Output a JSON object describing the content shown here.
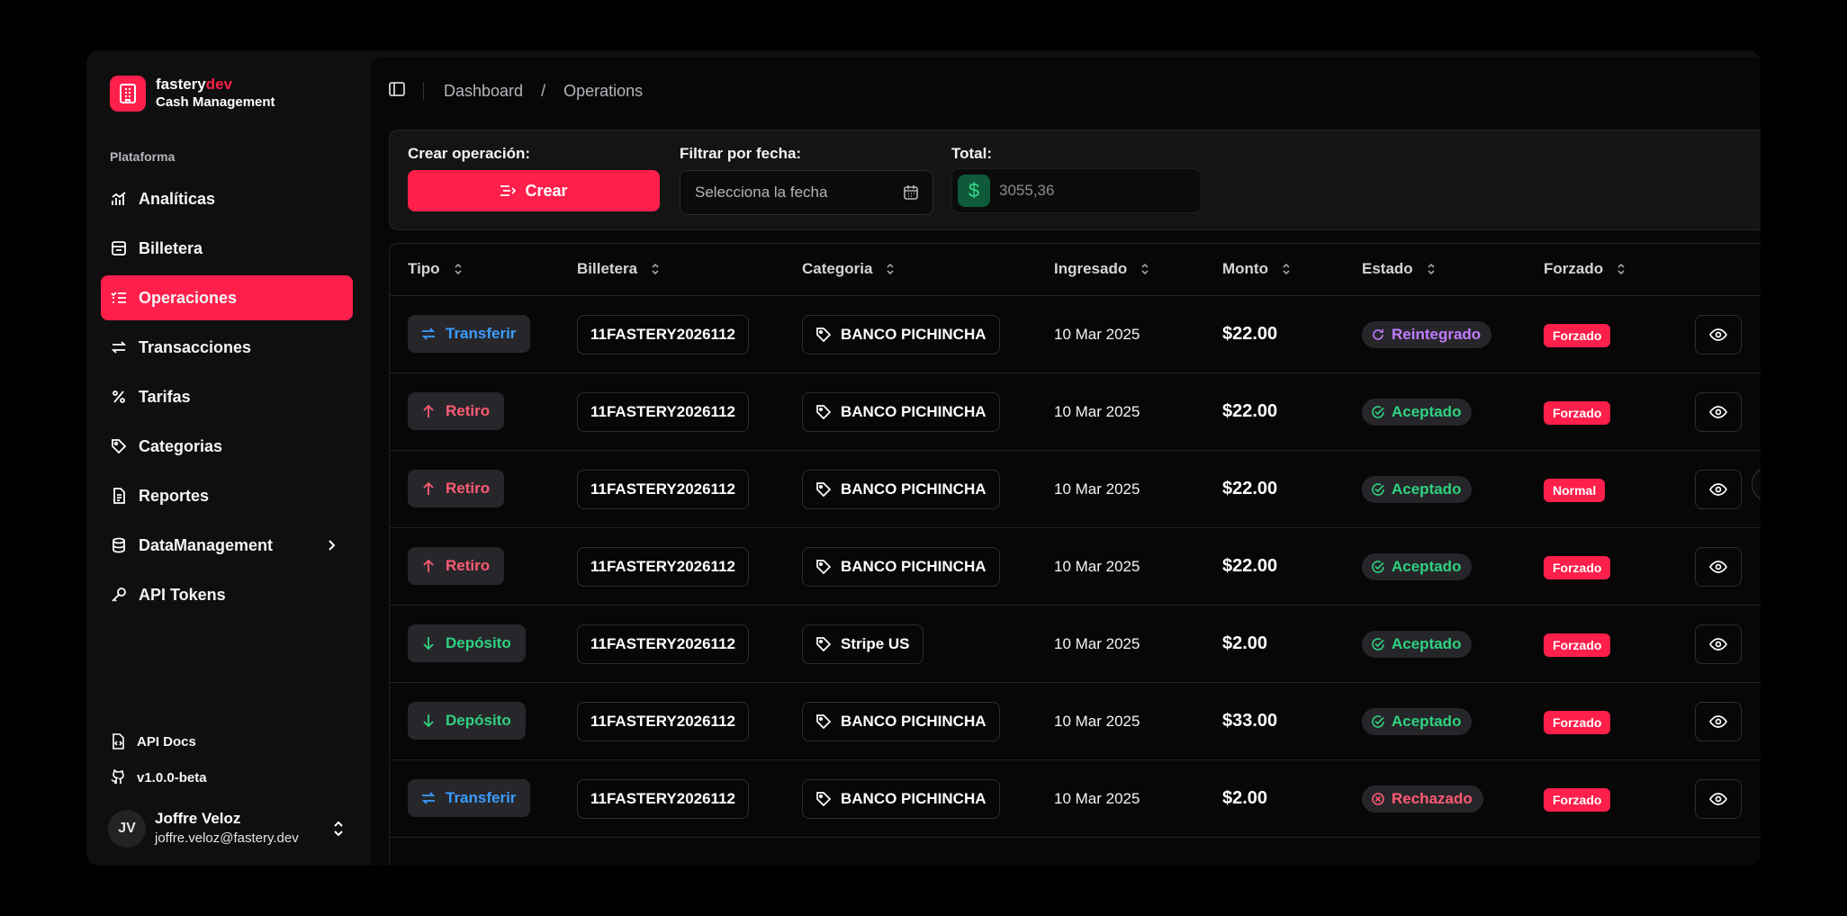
{
  "brand": {
    "name_main": "fastery",
    "name_accent": "dev",
    "subtitle": "Cash Management"
  },
  "sidebar": {
    "section_label": "Plataforma",
    "items": [
      {
        "label": "Analíticas",
        "icon": "chart-icon",
        "active": false
      },
      {
        "label": "Billetera",
        "icon": "wallet-icon",
        "active": false
      },
      {
        "label": "Operaciones",
        "icon": "list-check-icon",
        "active": true
      },
      {
        "label": "Transacciones",
        "icon": "arrows-exchange-icon",
        "active": false
      },
      {
        "label": "Tarifas",
        "icon": "percent-icon",
        "active": false
      },
      {
        "label": "Categorias",
        "icon": "tag-icon",
        "active": false
      },
      {
        "label": "Reportes",
        "icon": "document-icon",
        "active": false
      },
      {
        "label": "DataManagement",
        "icon": "database-icon",
        "active": false
      },
      {
        "label": "API Tokens",
        "icon": "key-icon",
        "active": false
      }
    ],
    "footer_links": [
      {
        "label": "API Docs",
        "icon": "file-code-icon"
      },
      {
        "label": "v1.0.0-beta",
        "icon": "github-icon"
      }
    ],
    "user": {
      "initials": "JV",
      "name": "Joffre Veloz",
      "email": "joffre.veloz@fastery.dev"
    }
  },
  "breadcrumb": {
    "first": "Dashboard",
    "separator": "/",
    "current": "Operations"
  },
  "controls": {
    "create_label": "Crear operación:",
    "create_button": "Crear",
    "filter_label": "Filtrar por fecha:",
    "date_placeholder": "Selecciona la fecha",
    "total_label": "Total:",
    "total_value": "3055,36"
  },
  "table": {
    "columns": [
      "Tipo",
      "Billetera",
      "Categoria",
      "Ingresado",
      "Monto",
      "Estado",
      "Forzado"
    ],
    "rows": [
      {
        "tipo": "Transferir",
        "tipo_kind": "blue",
        "billetera": "11FASTERY2026112",
        "categoria": "BANCO PICHINCHA",
        "ingresado": "10 Mar 2025",
        "monto": "$22.00",
        "estado": "Reintegrado",
        "estado_kind": "purple",
        "forzado": "Forzado"
      },
      {
        "tipo": "Retiro",
        "tipo_kind": "red",
        "billetera": "11FASTERY2026112",
        "categoria": "BANCO PICHINCHA",
        "ingresado": "10 Mar 2025",
        "monto": "$22.00",
        "estado": "Aceptado",
        "estado_kind": "green",
        "forzado": "Forzado"
      },
      {
        "tipo": "Retiro",
        "tipo_kind": "red",
        "billetera": "11FASTERY2026112",
        "categoria": "BANCO PICHINCHA",
        "ingresado": "10 Mar 2025",
        "monto": "$22.00",
        "estado": "Aceptado",
        "estado_kind": "green",
        "forzado": "Normal"
      },
      {
        "tipo": "Retiro",
        "tipo_kind": "red",
        "billetera": "11FASTERY2026112",
        "categoria": "BANCO PICHINCHA",
        "ingresado": "10 Mar 2025",
        "monto": "$22.00",
        "estado": "Aceptado",
        "estado_kind": "green",
        "forzado": "Forzado"
      },
      {
        "tipo": "Depósito",
        "tipo_kind": "green",
        "billetera": "11FASTERY2026112",
        "categoria": "Stripe US",
        "ingresado": "10 Mar 2025",
        "monto": "$2.00",
        "estado": "Aceptado",
        "estado_kind": "green",
        "forzado": "Forzado"
      },
      {
        "tipo": "Depósito",
        "tipo_kind": "green",
        "billetera": "11FASTERY2026112",
        "categoria": "BANCO PICHINCHA",
        "ingresado": "10 Mar 2025",
        "monto": "$33.00",
        "estado": "Aceptado",
        "estado_kind": "green",
        "forzado": "Forzado"
      },
      {
        "tipo": "Transferir",
        "tipo_kind": "blue",
        "billetera": "11FASTERY2026112",
        "categoria": "BANCO PICHINCHA",
        "ingresado": "10 Mar 2025",
        "monto": "$2.00",
        "estado": "Rechazado",
        "estado_kind": "red",
        "forzado": "Forzado"
      }
    ]
  },
  "colors": {
    "accent": "#ff1f4b",
    "background": "#070707",
    "success": "#2fd17f",
    "info": "#3b9cff",
    "purple": "#c07cff"
  }
}
